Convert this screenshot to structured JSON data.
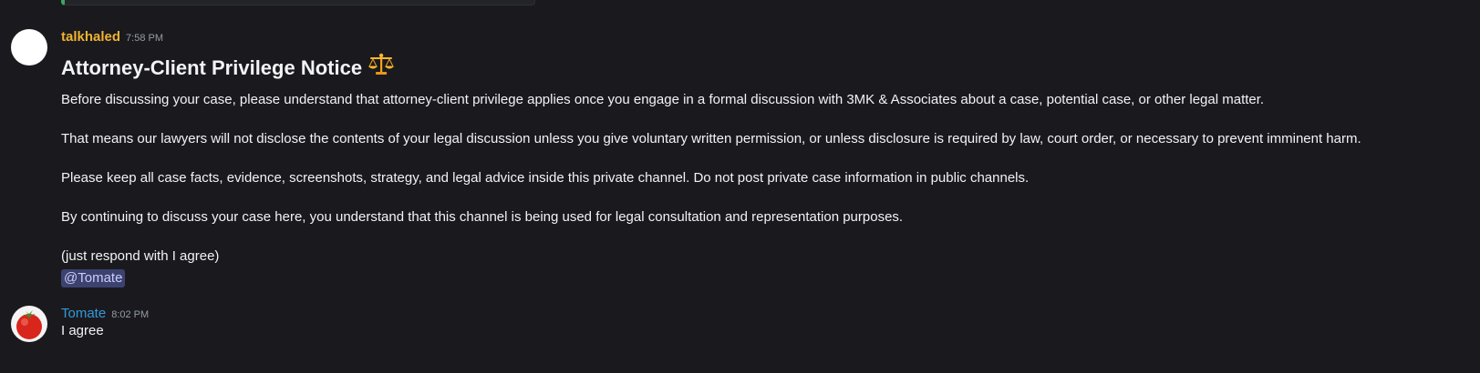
{
  "colors": {
    "background": "#1a1a1e",
    "username_1": "#f0b232",
    "username_2": "#3498db",
    "mention_bg": "#3c4270",
    "mention_text": "#c9cdfb",
    "embed_bar": "#3ba55d"
  },
  "messages": [
    {
      "author": "talkhaled",
      "time": "7:58 PM",
      "avatar_icon": "white-circle-avatar",
      "title": "Attorney-Client Privilege Notice",
      "title_icon": "balance-scale-icon",
      "paragraphs": [
        "Before discussing your case, please understand that attorney-client privilege applies once you engage in a formal discussion with 3MK & Associates about a case, potential case, or other legal matter.",
        "That means our lawyers will not disclose the contents of your legal discussion unless you give voluntary written permission, or unless disclosure is required by law, court order, or necessary to prevent imminent harm.",
        "Please keep all case facts, evidence, screenshots, strategy, and legal advice inside this private channel. Do not post private case information in public channels.",
        "By continuing to discuss your case here, you understand that this channel is being used for legal consultation and representation purposes.",
        "(just respond with I agree)"
      ],
      "mention": "@Tomate"
    },
    {
      "author": "Tomate",
      "time": "8:02 PM",
      "avatar_icon": "tomato-avatar",
      "text": "I agree"
    }
  ]
}
